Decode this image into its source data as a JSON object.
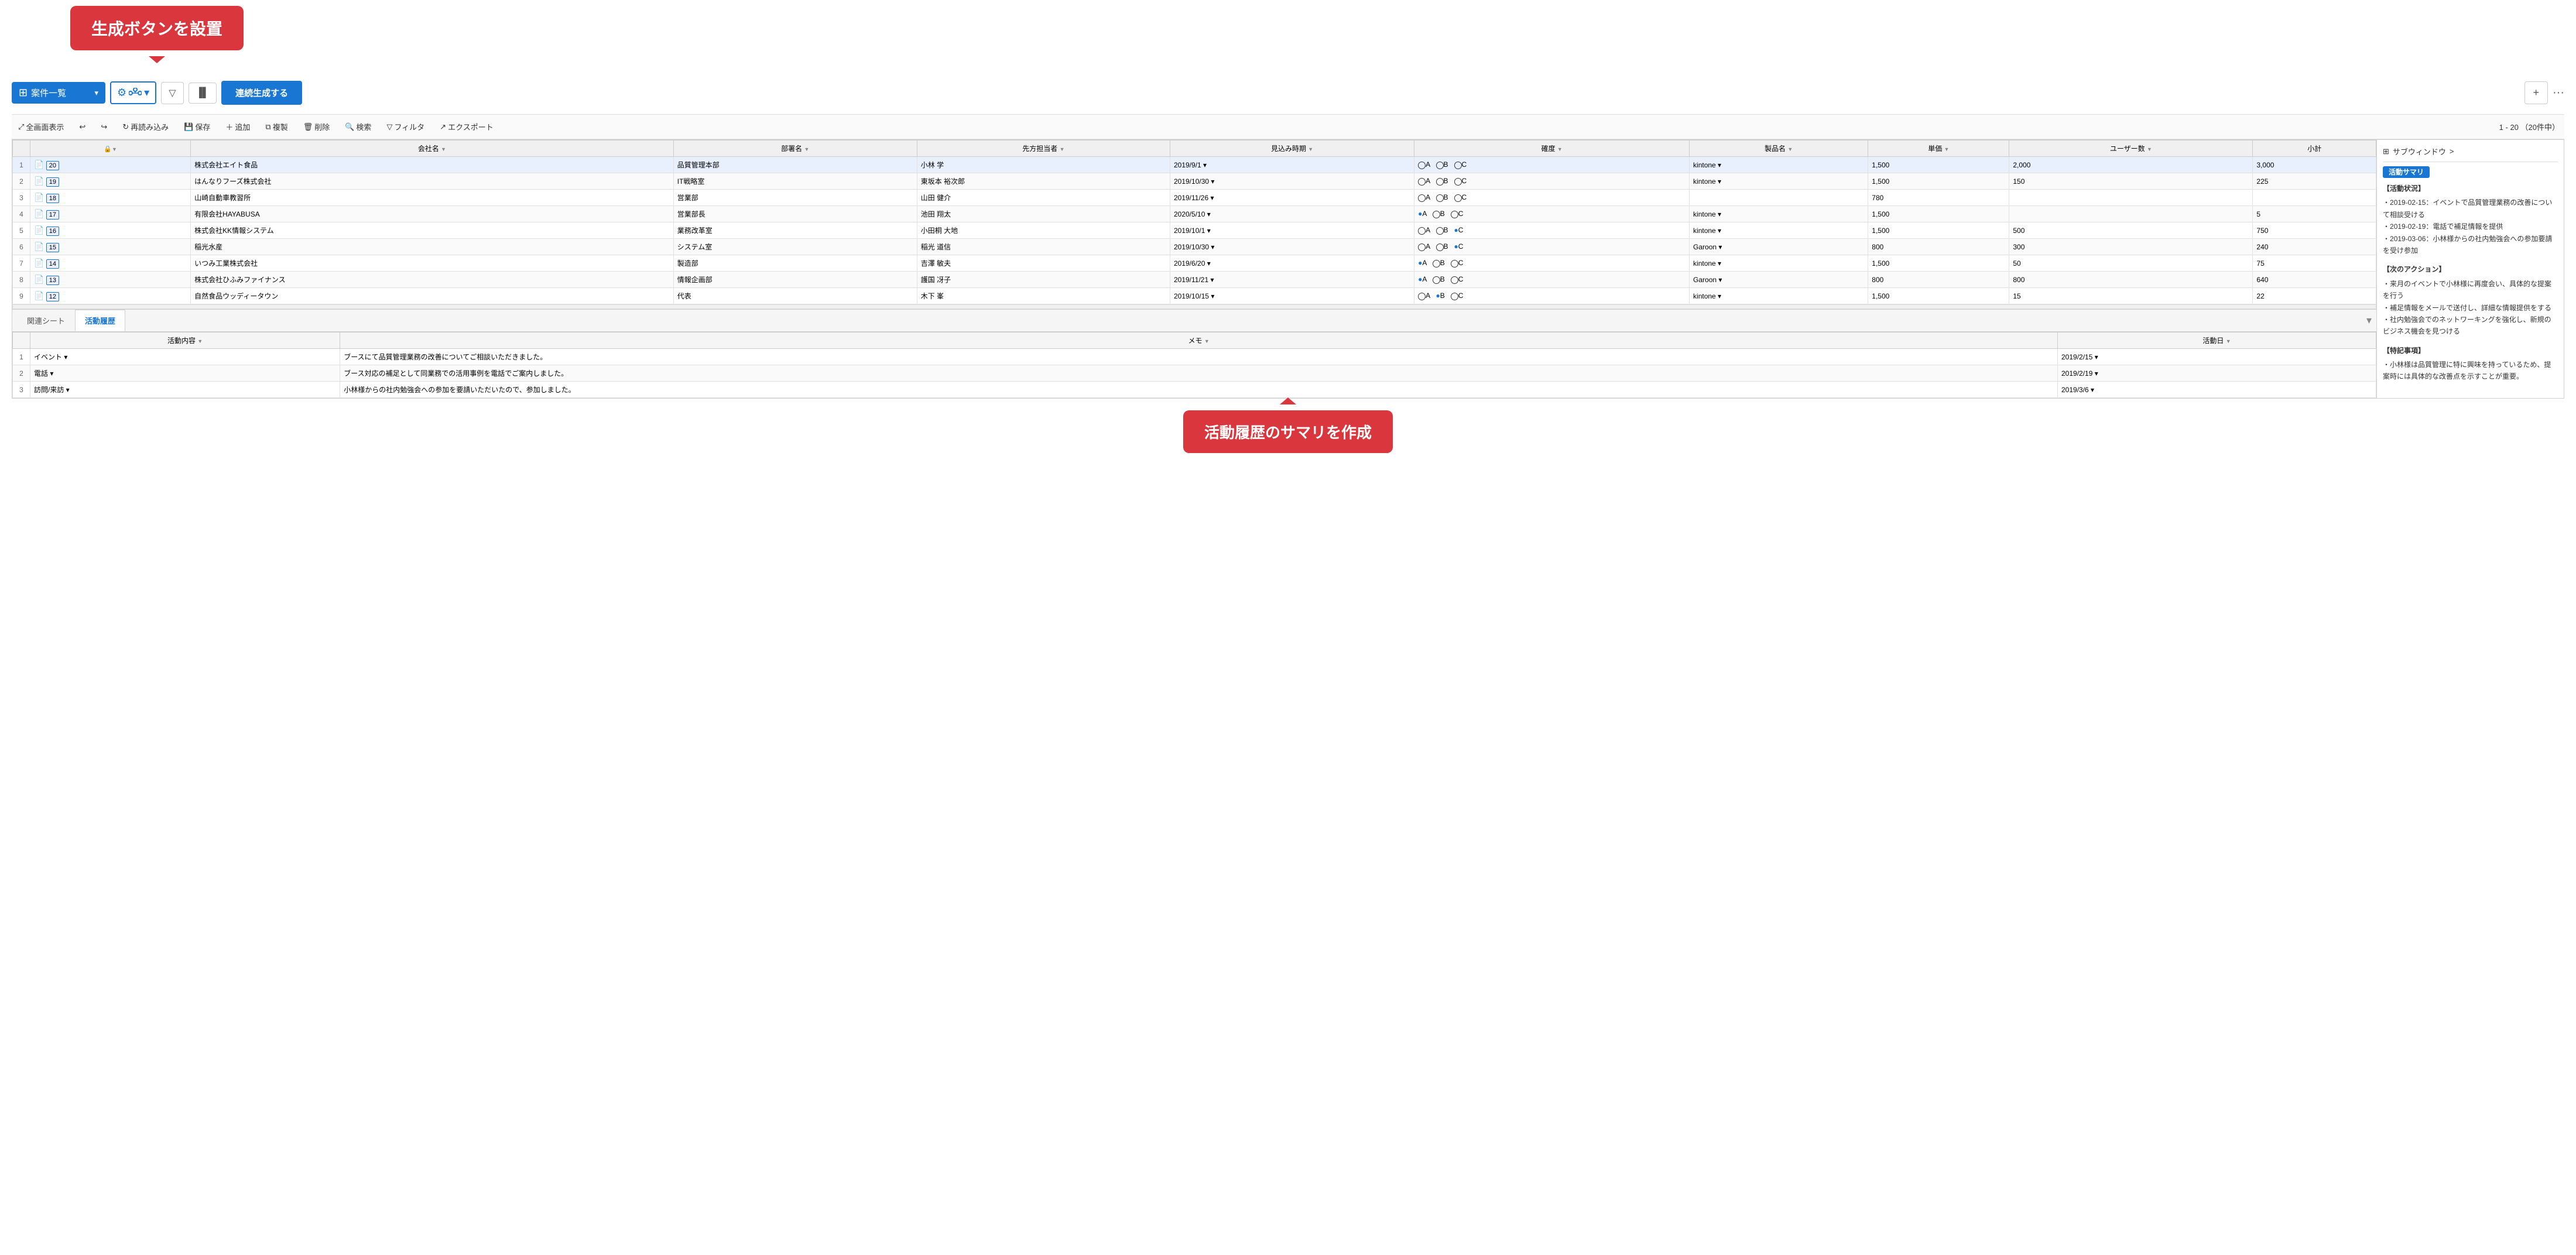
{
  "callout_top": {
    "text": "生成ボタンを設置"
  },
  "toolbar": {
    "view_label": "案件一覧",
    "flow_btn_label": "⚙",
    "filter_btn_label": "▼",
    "chart_btn_label": "⬛",
    "generate_btn_label": "連続生成する",
    "plus_btn_label": "+",
    "more_btn_label": "···"
  },
  "toolbar2": {
    "fullscreen_label": "全画面表示",
    "undo_label": "↩",
    "redo_label": "↪",
    "reload_label": "再読み込み",
    "save_label": "保存",
    "add_label": "追加",
    "copy_label": "複製",
    "delete_label": "削除",
    "search_label": "検索",
    "filter_label": "フィルタ",
    "export_label": "エクスポート",
    "pagination_label": "1 - 20 （20件中）"
  },
  "table": {
    "columns": [
      "レ▼",
      "会社名",
      "部署名",
      "先方担当者",
      "見込み時期",
      "確度",
      "製品名",
      "単価",
      "ユーザー数",
      "小計"
    ],
    "rows": [
      {
        "num": "1",
        "rec": "20",
        "company": "株式会社エイト食品",
        "dept": "品質管理本部",
        "person": "小林 学",
        "date": "2019/9/1",
        "conf_a": "○A",
        "conf_b": "○B",
        "conf_c": "○C",
        "product": "kintone",
        "price": "1,500",
        "users": "2,000",
        "subtotal": "3,000"
      },
      {
        "num": "2",
        "rec": "19",
        "company": "はんなりフーズ株式会社",
        "dept": "IT戦略室",
        "person": "東坂本 裕次郎",
        "date": "2019/10/30",
        "conf_a": "○A",
        "conf_b": "○B",
        "conf_c": "○C",
        "product": "kintone",
        "price": "1,500",
        "users": "150",
        "subtotal": "225"
      },
      {
        "num": "3",
        "rec": "18",
        "company": "山崎自動車教習所",
        "dept": "営業部",
        "person": "山田 健介",
        "date": "2019/11/26",
        "conf_a": "○A",
        "conf_b": "○B",
        "conf_c": "○C",
        "product": "",
        "price": "780",
        "users": "",
        "subtotal": ""
      },
      {
        "num": "4",
        "rec": "17",
        "company": "有限会社HAYABUSA",
        "dept": "営業部長",
        "person": "池田 翔太",
        "date": "2020/5/10",
        "conf_a": "●A",
        "conf_b": "○B",
        "conf_c": "○C",
        "product": "kintone",
        "price": "1,500",
        "users": "",
        "subtotal": "5"
      },
      {
        "num": "5",
        "rec": "16",
        "company": "株式会社KK情報システム",
        "dept": "業務改革室",
        "person": "小田桐 大地",
        "date": "2019/10/1",
        "conf_a": "○A",
        "conf_b": "○B",
        "conf_c": "●C",
        "product": "kintone",
        "price": "1,500",
        "users": "500",
        "subtotal": "750"
      },
      {
        "num": "6",
        "rec": "15",
        "company": "稲光水産",
        "dept": "システム室",
        "person": "稲光 道信",
        "date": "2019/10/30",
        "conf_a": "○A",
        "conf_b": "○B",
        "conf_c": "●C",
        "product": "Garoon",
        "price": "800",
        "users": "300",
        "subtotal": "240"
      },
      {
        "num": "7",
        "rec": "14",
        "company": "いつみ工業株式会社",
        "dept": "製造部",
        "person": "吉澤 敏夫",
        "date": "2019/6/20",
        "conf_a": "●A",
        "conf_b": "○B",
        "conf_c": "○C",
        "product": "kintone",
        "price": "1,500",
        "users": "50",
        "subtotal": "75"
      },
      {
        "num": "8",
        "rec": "13",
        "company": "株式会社ひふみファイナンス",
        "dept": "情報企画部",
        "person": "護国 冴子",
        "date": "2019/11/21",
        "conf_a": "●A",
        "conf_b": "○B",
        "conf_c": "○C",
        "product": "Garoon",
        "price": "800",
        "users": "800",
        "subtotal": "640"
      },
      {
        "num": "9",
        "rec": "12",
        "company": "自然食品ウッディータウン",
        "dept": "代表",
        "person": "木下 峯",
        "date": "2019/10/15",
        "conf_a": "○A",
        "conf_b": "●B",
        "conf_c": "○C",
        "product": "kintone",
        "price": "1,500",
        "users": "15",
        "subtotal": "22"
      }
    ]
  },
  "related": {
    "tab1": "関連シート",
    "tab2": "活動履歴",
    "columns": [
      "活動内容",
      "メモ",
      "活動日"
    ],
    "rows": [
      {
        "num": "1",
        "type": "イベント",
        "memo": "ブースにて品質管理業務の改善についてご相談いただきました。",
        "date": "2019/2/15"
      },
      {
        "num": "2",
        "type": "電話",
        "memo": "ブース対応の補足として同業務での活用事例を電話でご案内しました。",
        "date": "2019/2/19"
      },
      {
        "num": "3",
        "type": "訪問/来訪",
        "memo": "小林様からの社内勉強会への参加を要請いただいたので、参加しました。",
        "date": "2019/3/6"
      }
    ]
  },
  "subwindow": {
    "header": "サブウィンドウ",
    "chevron": ">",
    "badge": "活動サマリ",
    "section1_title": "【活動状況】",
    "section1_items": [
      "2019-02-15：イベントで品質管理業務の改善について相談受ける",
      "2019-02-19：電話で補足情報を提供",
      "2019-03-06：小林様からの社内勉強会への参加要請を受け参加"
    ],
    "section2_title": "【次のアクション】",
    "section2_items": [
      "来月のイベントで小林様に再度会い、具体的な提案を行う",
      "補足情報をメールで送付し、詳細な情報提供をする",
      "社内勉強会でのネットワーキングを強化し、新規のビジネス機会を見つける"
    ],
    "section3_title": "【特記事項】",
    "section3_items": [
      "小林様は品質管理に特に興味を持っているため、提案時には具体的な改善点を示すことが重要。"
    ]
  },
  "callout_bottom": {
    "text": "活動履歴のサマリを作成"
  }
}
